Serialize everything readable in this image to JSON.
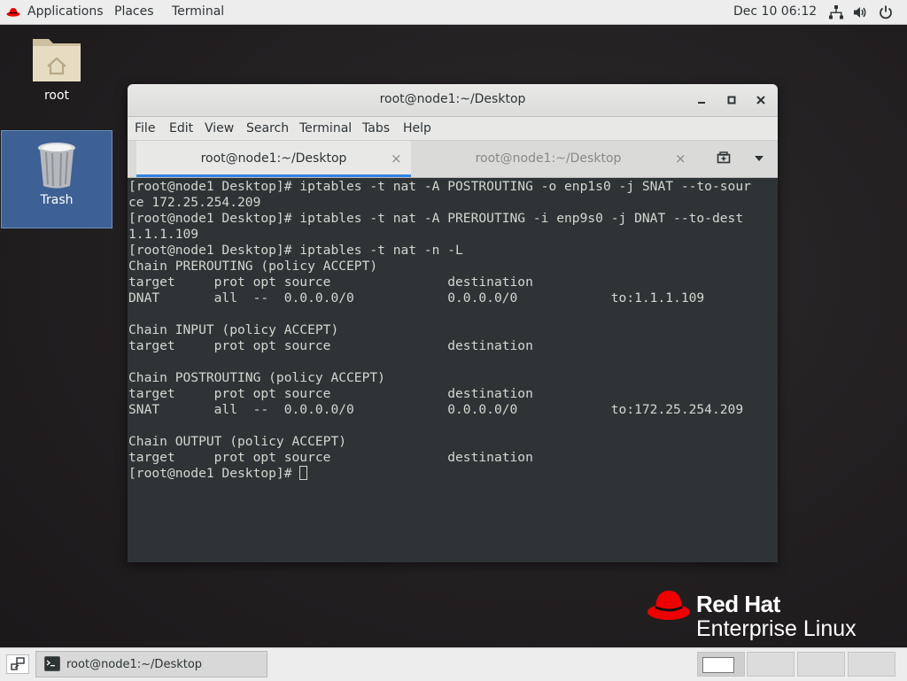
{
  "topbar": {
    "applications": "Applications",
    "places": "Places",
    "terminal": "Terminal",
    "clock": "Dec 10  06:12",
    "icons": [
      "network-icon",
      "volume-icon",
      "power-icon"
    ]
  },
  "desktop": {
    "icons": [
      {
        "label": "root",
        "icon": "home-folder-icon"
      },
      {
        "label": "Trash",
        "icon": "trash-icon"
      }
    ]
  },
  "window": {
    "title": "root@node1:~/Desktop",
    "menu": [
      "File",
      "Edit",
      "View",
      "Search",
      "Terminal",
      "Tabs",
      "Help"
    ],
    "tabs": [
      {
        "label": "root@node1:~/Desktop",
        "active": true
      },
      {
        "label": "root@node1:~/Desktop",
        "active": false
      }
    ],
    "terminal_lines": [
      "[root@node1 Desktop]# iptables -t nat -A POSTROUTING -o enp1s0 -j SNAT --to-sour",
      "ce 172.25.254.209",
      "[root@node1 Desktop]# iptables -t nat -A PREROUTING -i enp9s0 -j DNAT --to-dest",
      "1.1.1.109",
      "[root@node1 Desktop]# iptables -t nat -n -L",
      "Chain PREROUTING (policy ACCEPT)",
      "target     prot opt source               destination",
      "DNAT       all  --  0.0.0.0/0            0.0.0.0/0            to:1.1.1.109",
      "",
      "Chain INPUT (policy ACCEPT)",
      "target     prot opt source               destination",
      "",
      "Chain POSTROUTING (policy ACCEPT)",
      "target     prot opt source               destination",
      "SNAT       all  --  0.0.0.0/0            0.0.0.0/0            to:172.25.254.209",
      "",
      "Chain OUTPUT (policy ACCEPT)",
      "target     prot opt source               destination"
    ],
    "prompt": "[root@node1 Desktop]# "
  },
  "branding": {
    "line1": "Red Hat",
    "line2": "Enterprise Linux",
    "color": "#ee0000"
  },
  "taskbar": {
    "task_label": "root@node1:~/Desktop",
    "workspaces": 4
  }
}
